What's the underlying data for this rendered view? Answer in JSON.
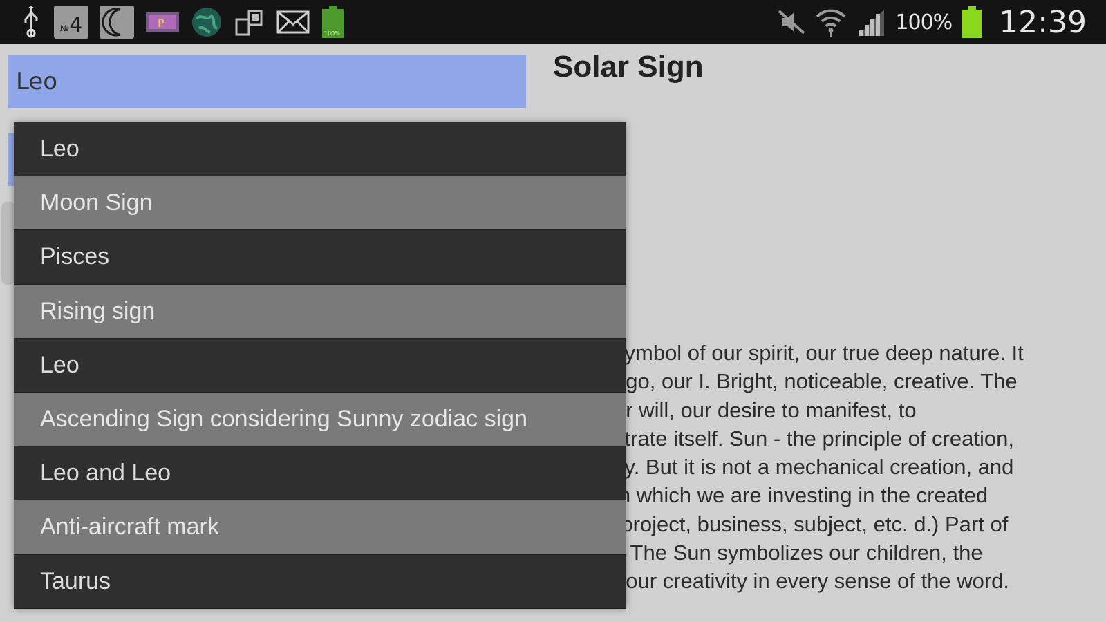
{
  "status_bar": {
    "notification_number": "4",
    "notification_prefix": "№",
    "battery_percent": "100%",
    "time": "12:39",
    "icons_left": [
      "usb-icon",
      "number-badge-icon",
      "moon-icon",
      "app-icon",
      "globe-icon",
      "sync-icon",
      "mail-icon",
      "battery-full-notification-icon"
    ],
    "icons_right": [
      "mute-icon",
      "wifi-icon",
      "signal-icon",
      "battery-icon"
    ]
  },
  "search": {
    "value": "Leo"
  },
  "page": {
    "title": "Solar Sign",
    "body_lines": [
      "symbol of our spirit, our true deep nature. It",
      "ego, our I. Bright, noticeable, creative. The",
      "ur will, our desire to manifest, to",
      "strate itself. Sun - the principle of creation,",
      "ity. But it is not a mechanical creation, and",
      "in which we are investing in the created",
      "(project, business, subject, etc. d.) Part of",
      "l. The Sun symbolizes our children, the",
      "f our creativity in every sense of the word."
    ]
  },
  "dropdown": {
    "items": [
      {
        "label": "Leo",
        "style": "dark"
      },
      {
        "label": "Moon Sign",
        "style": "light"
      },
      {
        "label": "Pisces",
        "style": "dark"
      },
      {
        "label": "Rising sign",
        "style": "light"
      },
      {
        "label": "Leo",
        "style": "dark"
      },
      {
        "label": "Ascending Sign considering Sunny zodiac sign",
        "style": "light"
      },
      {
        "label": "Leo and Leo",
        "style": "dark"
      },
      {
        "label": "Anti-aircraft mark",
        "style": "light"
      },
      {
        "label": "Taurus",
        "style": "dark"
      }
    ]
  },
  "colors": {
    "search_bg": "#8fa7e8",
    "battery_green": "#8ad81e",
    "background": "#d1d1d1"
  }
}
